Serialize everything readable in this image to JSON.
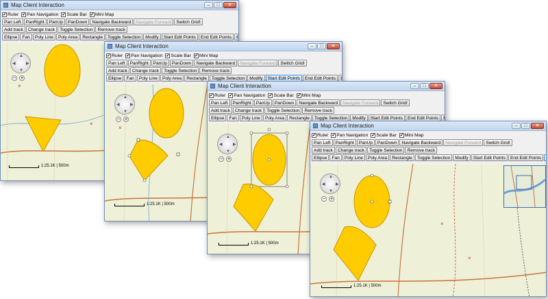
{
  "window": {
    "title": "Map Client Interaction"
  },
  "checkboxes": [
    {
      "label": "Ruler",
      "checked": true
    },
    {
      "label": "Pan Navigation",
      "checked": true
    },
    {
      "label": "Scale Bar",
      "checked": true
    },
    {
      "label": "Mini Map",
      "checked": true
    }
  ],
  "buttons_row1": [
    "Pan Left",
    "PanRight",
    "PanUp",
    "PanDown",
    "Navigate Backward",
    "Navigate Forward",
    "Switch Grid!"
  ],
  "buttons_row2": [
    "Add track",
    "Change track",
    "Toggle Selection",
    "Remove track"
  ],
  "buttons_row3": [
    "Ellipse",
    "Fan",
    "Poly Line",
    "Poly Area",
    "Rectangle",
    "Toggle Selection",
    "Modify",
    "Start Edit Points",
    "End Edit Points",
    "Edit Pts Cmnd"
  ],
  "scale_label": "1:25.1K | 500m",
  "window_controls": {
    "minimize": "–",
    "maximize": "□",
    "close": "✕"
  },
  "zoom": {
    "out": "−",
    "in": "+"
  },
  "check_mark": "✔",
  "colors": {
    "shape_fill": "#ffcc00",
    "shape_stroke": "#c79400",
    "road": "#c8733a",
    "stream": "#6fa0d6",
    "map_bg": "#eef1d8"
  },
  "disabled_button": "Navigate Forward",
  "active_button_per_window": [
    "",
    "Start Edit Points",
    "",
    "Edit Pts Cmnd"
  ]
}
